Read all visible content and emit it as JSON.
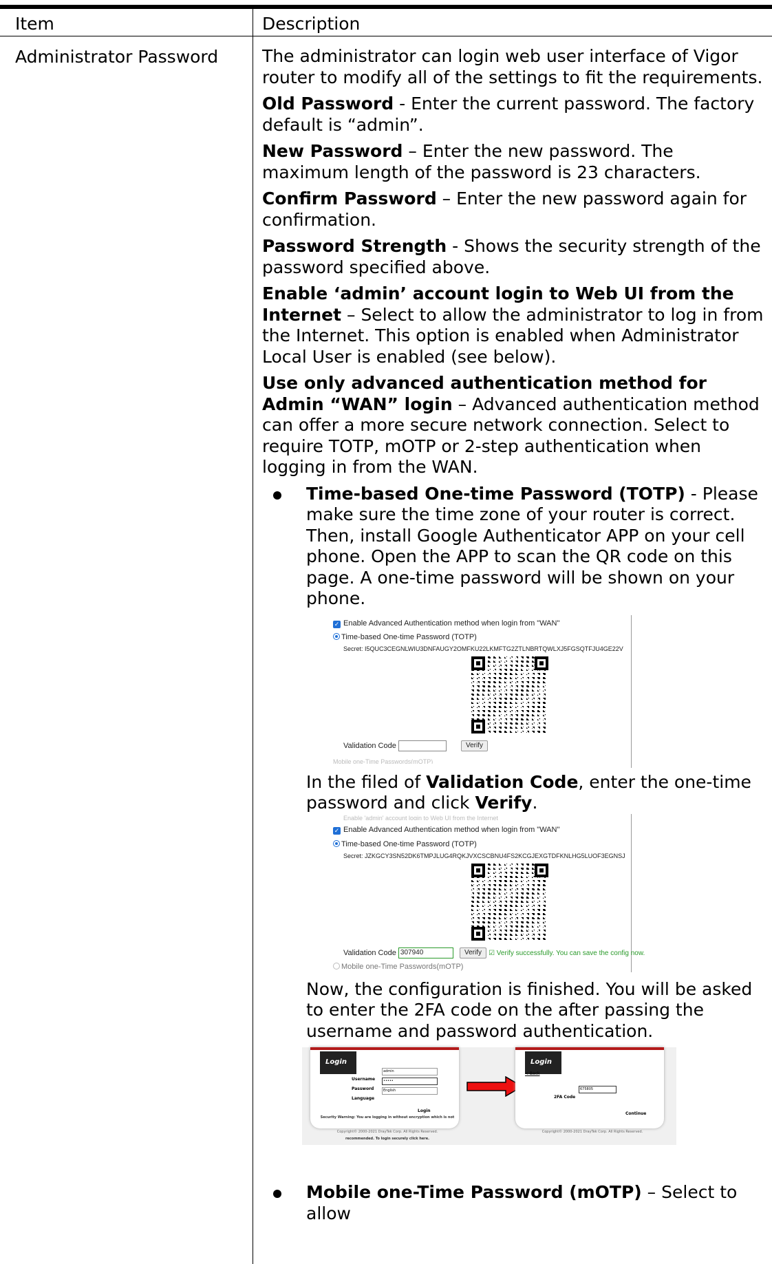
{
  "table": {
    "headers": [
      "Item",
      "Description"
    ],
    "item": "Administrator Password"
  },
  "desc": {
    "intro": "The administrator can login web user interface of Vigor router to modify all of the settings to fit the requirements.",
    "old_pw_label": "Old Password",
    "old_pw_text": " - Enter the current password. The factory default is “admin”.",
    "new_pw_label": "New Password",
    "new_pw_text": " – Enter the new password. The maximum length of the password is 23 characters.",
    "confirm_pw_label": "Confirm Password",
    "confirm_pw_text": " – Enter the new password again for confirmation.",
    "strength_label": "Password Strength",
    "strength_text": " - Shows the security strength of the password specified above.",
    "enable_admin_label": "Enable ‘admin’ account login to Web UI from the Internet",
    "enable_admin_text": " – Select to allow the administrator to log in from the Internet. This option is enabled when Administrator Local User is enabled (see below).",
    "adv_label": "Use only advanced authentication method for Admin “WAN” login",
    "adv_text": " – Advanced authentication method can offer a more secure network connection. Select to require TOTP, mOTP or 2-step authentication when logging in from the WAN.",
    "totp_label": "Time-based One-time Password (TOTP)",
    "totp_text": " - Please make sure the time zone of your router is correct. Then, install Google Authenticator APP on your cell phone. Open the APP to scan the QR code on this page. A one-time password will be shown on your phone.",
    "validation_pre": "In the filed of ",
    "validation_label": "Validation Code",
    "validation_mid": ", enter the one-time password and click ",
    "verify_label": "Verify",
    "validation_end": ".",
    "finished_text": "Now, the configuration is finished. You will be asked to enter the 2FA code on the after passing the username and password authentication.",
    "motp_label": "Mobile one-Time Password (mOTP)",
    "motp_text": " – Select to allow"
  },
  "shot1": {
    "enable_adv": "Enable Advanced Authentication method when login from \"WAN\"",
    "totp": "Time-based One-time Password (TOTP)",
    "secret": "Secret:  I5QUC3CEGNLWIU3DNFAUGY2OMFKU22LKMFTG2ZTLNBRTQWLXJ5FGSQTFJU4GE22V",
    "validation": "Validation Code",
    "verify": "Verify",
    "faded": "Mobile one-Time Passwords(mOTP)"
  },
  "shot2": {
    "faded_top": "Enable 'admin' account login to Web UI from the Internet",
    "enable_adv": "Enable Advanced Authentication method when login from \"WAN\"",
    "totp": "Time-based One-time Password (TOTP)",
    "secret": "Secret:  JZKGCY3SN52DK6TMPJLUG4RQKJVXCSCBNU4FS2KCGJEXGTDFKNLHG5LUOF3EGNSJ",
    "validation": "Validation Code",
    "code_value": "307940",
    "verify": "Verify",
    "success": "☑ Verify successfully. You can save the config now.",
    "motp": "Mobile one-Time Passwords(mOTP)"
  },
  "login_left": {
    "tag": "Login",
    "username_label": "Username",
    "username_value": "admin",
    "password_label": "Password",
    "password_value": "•••••",
    "language_label": "Language",
    "language_value": "English",
    "login_btn": "Login",
    "warning": "Security Warning: You are logging in without encryption which is not recommended. To login securely click here.",
    "copyright": "Copyright© 2000-2021 DrayTek Corp. All Rights Reserved."
  },
  "login_right": {
    "tag": "Login",
    "back": "< Back",
    "code_label": "2FA Code",
    "code_value": "675805",
    "continue_btn": "Continue",
    "copyright": "Copyright© 2000-2021 DrayTek Corp. All Rights Reserved."
  }
}
